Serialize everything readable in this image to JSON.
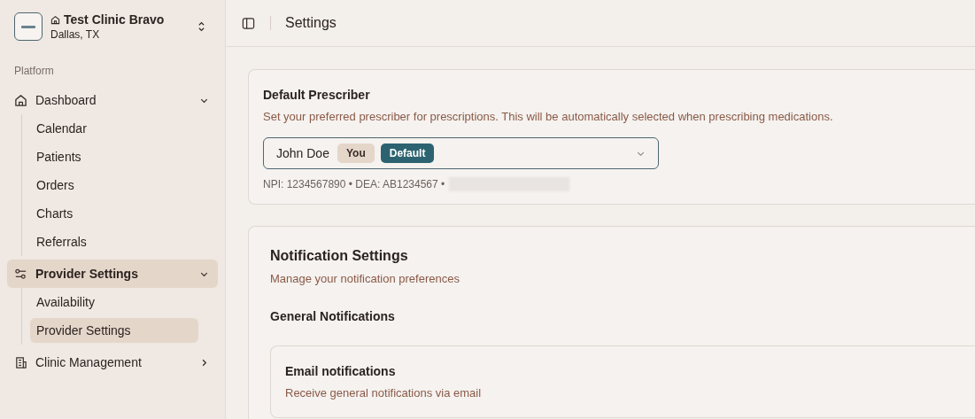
{
  "clinic": {
    "name": "Test Clinic Bravo",
    "location": "Dallas, TX"
  },
  "sidebar": {
    "section_label": "Platform",
    "groups": [
      {
        "label": "Dashboard",
        "expanded": true,
        "selected": false,
        "children": [
          {
            "label": "Calendar",
            "selected": false
          },
          {
            "label": "Patients",
            "selected": false
          },
          {
            "label": "Orders",
            "selected": false
          },
          {
            "label": "Charts",
            "selected": false
          },
          {
            "label": "Referrals",
            "selected": false
          }
        ]
      },
      {
        "label": "Provider Settings",
        "expanded": true,
        "selected": true,
        "children": [
          {
            "label": "Availability",
            "selected": false
          },
          {
            "label": "Provider Settings",
            "selected": true
          }
        ]
      },
      {
        "label": "Clinic Management",
        "expanded": false,
        "selected": false
      }
    ]
  },
  "header": {
    "title": "Settings"
  },
  "default_prescriber": {
    "title": "Default Prescriber",
    "description": "Set your preferred prescriber for prescriptions. This will be automatically selected when prescribing medications.",
    "selected_name": "John Doe",
    "badges": [
      {
        "label": "You",
        "kind": "you"
      },
      {
        "label": "Default",
        "kind": "default"
      }
    ],
    "details": "NPI: 1234567890 • DEA: AB1234567 •"
  },
  "notifications": {
    "title": "Notification Settings",
    "subtitle": "Manage your notification preferences",
    "section": "General Notifications",
    "items": [
      {
        "title": "Email notifications",
        "description": "Receive general notifications via email"
      }
    ]
  }
}
